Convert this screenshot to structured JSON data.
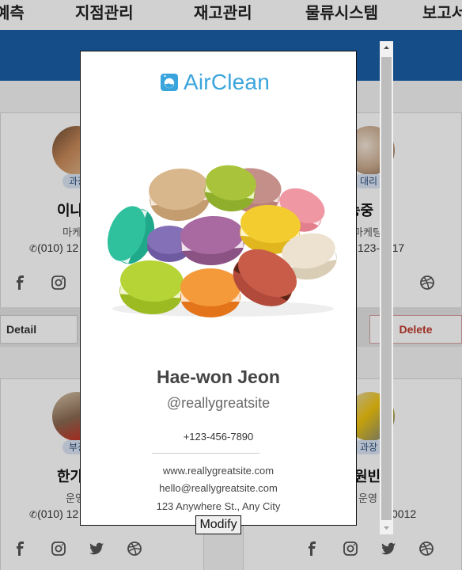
{
  "topnav": {
    "items": [
      "예측",
      "지점관리",
      "재고관리",
      "물류시스템",
      "보고서"
    ]
  },
  "background_cards": {
    "top_left": {
      "tag": "과장",
      "name": "이나",
      "role": "마케",
      "phone": "(010) 12"
    },
    "top_right": {
      "tag": "대리",
      "name": "송중",
      "role": "마케팅",
      "phone": "123-0017"
    },
    "bottom_left": {
      "tag": "부장",
      "name": "한가",
      "role": "운영",
      "phone": "(010) 12"
    },
    "bottom_right": {
      "tag": "과장",
      "name": "원빈",
      "role": "운영",
      "phone": "0012"
    },
    "detail_label": "Detail",
    "delete_label": "Delete"
  },
  "modal": {
    "logo_text": "AirClean",
    "name": "Hae-won Jeon",
    "handle": "@reallygreatsite",
    "phone": "+123-456-7890",
    "website": "www.reallygreatsite.com",
    "email": "hello@reallygreatsite.com",
    "address": "123 Anywhere St., Any City",
    "modify_label": "Modify"
  },
  "colors": {
    "brand_blue": "#1a5ea8",
    "logo_blue": "#3aa5dc",
    "delete_red": "#c0392b"
  },
  "icons": [
    "facebook-icon",
    "instagram-icon",
    "twitter-icon",
    "dribbble-icon",
    "phone-icon",
    "scroll-up-arrow-icon",
    "scroll-down-arrow-icon"
  ]
}
